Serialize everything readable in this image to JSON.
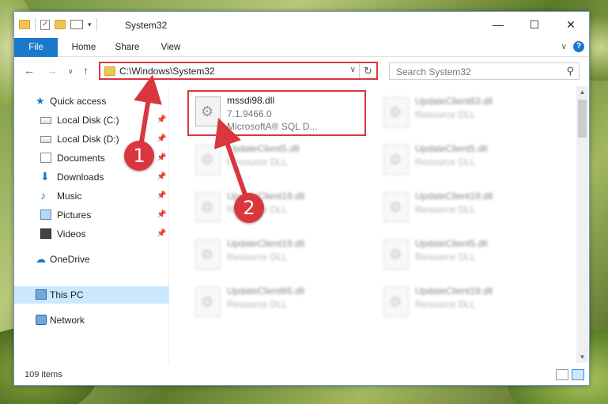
{
  "window": {
    "title": "System32",
    "controls": {
      "minimize": "—",
      "maximize": "☐",
      "close": "✕"
    }
  },
  "ribbon": {
    "tabs": [
      "File",
      "Home",
      "Share",
      "View"
    ],
    "help": "?"
  },
  "nav": {
    "back": "←",
    "forward": "→",
    "recent": "∨",
    "up": "↑"
  },
  "address": {
    "path": "C:\\Windows\\System32",
    "dropdown": "∨",
    "refresh": "↻"
  },
  "search": {
    "placeholder": "Search System32",
    "icon": "search-icon"
  },
  "sidebar": {
    "quick_access": "Quick access",
    "items": [
      {
        "label": "Local Disk (C:)",
        "icon": "drive-icon",
        "pinned": true
      },
      {
        "label": "Local Disk (D:)",
        "icon": "drive-icon",
        "pinned": true
      },
      {
        "label": "Documents",
        "icon": "documents-icon",
        "pinned": true
      },
      {
        "label": "Downloads",
        "icon": "downloads-icon",
        "pinned": true
      },
      {
        "label": "Music",
        "icon": "music-icon",
        "pinned": true
      },
      {
        "label": "Pictures",
        "icon": "pictures-icon",
        "pinned": true
      },
      {
        "label": "Videos",
        "icon": "videos-icon",
        "pinned": true
      }
    ],
    "onedrive": "OneDrive",
    "this_pc": "This PC",
    "network": "Network"
  },
  "files": [
    {
      "name": "mssdi98.dll",
      "line2": "7.1.9466.0",
      "line3": "MicrosoftA® SQL D...",
      "highlighted": true
    },
    {
      "name": "UpdateClient63.dll",
      "line2": "Resource DLL",
      "line3": ""
    },
    {
      "name": "UpdateClient5.dll",
      "line2": "Resource DLL",
      "line3": ""
    },
    {
      "name": "UpdateClient5.dll",
      "line2": "Resource DLL",
      "line3": ""
    },
    {
      "name": "UpdateClient19.dll",
      "line2": "Resource DLL",
      "line3": ""
    },
    {
      "name": "UpdateClient19.dll",
      "line2": "Resource DLL",
      "line3": ""
    },
    {
      "name": "UpdateClient19.dll",
      "line2": "Resource DLL",
      "line3": ""
    },
    {
      "name": "UpdateClient5.dll",
      "line2": "Resource DLL",
      "line3": ""
    },
    {
      "name": "UpdateClient65.dll",
      "line2": "Resource DLL",
      "line3": ""
    },
    {
      "name": "UpdateClient19.dll",
      "line2": "Resource DLL",
      "line3": ""
    }
  ],
  "status": {
    "count": "109 items"
  },
  "callouts": {
    "one": "1",
    "two": "2"
  },
  "colors": {
    "accent": "#1979ca",
    "highlight": "#d9363e",
    "selected": "#cce8ff"
  }
}
